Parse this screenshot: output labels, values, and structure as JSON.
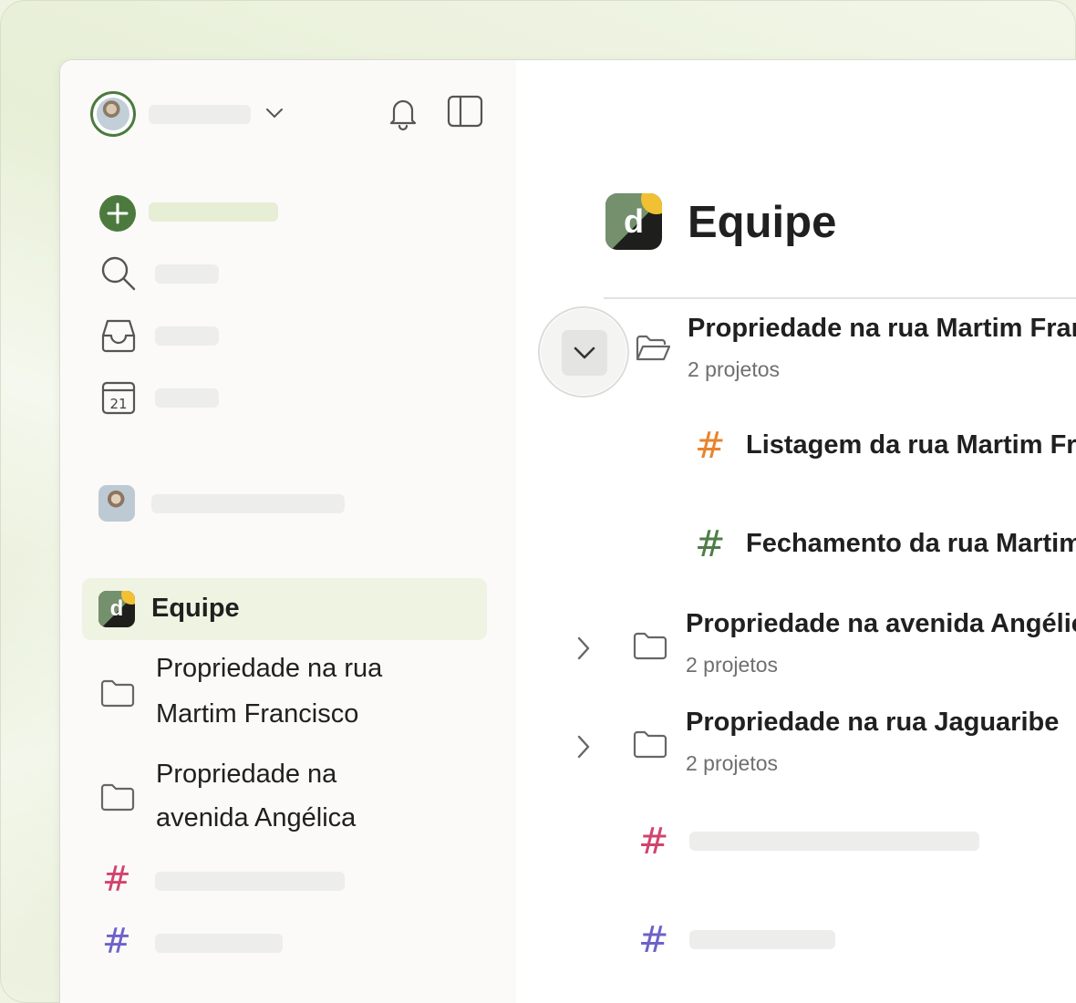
{
  "sidebar": {
    "icons": {
      "add": "plus-circle-icon",
      "search": "search-icon",
      "inbox": "inbox-icon",
      "calendar": "calendar-icon",
      "notifications": "bell-icon",
      "toggle_sidebar": "sidebar-toggle-icon"
    },
    "calendar_day": "21",
    "team": {
      "label": "Equipe",
      "logo_letter": "d"
    },
    "folders": [
      {
        "line1": "Propriedade na rua",
        "line2": "Martim Francisco"
      },
      {
        "line1": "Propriedade na",
        "line2": "avenida Angélica"
      }
    ]
  },
  "main": {
    "title": "Equipe",
    "logo_letter": "d",
    "folders": [
      {
        "title": "Propriedade na rua Martim Francisco",
        "subtitle": "2 projetos",
        "expanded": true,
        "projects": [
          {
            "title": "Listagem da rua Martim Francisco",
            "color": "#e8842d"
          },
          {
            "title": "Fechamento da rua Martim Francisco",
            "color": "#4f7d46"
          }
        ]
      },
      {
        "title": "Propriedade na avenida Angélica",
        "subtitle": "2 projetos",
        "expanded": false
      },
      {
        "title": "Propriedade na rua Jaguaribe",
        "subtitle": "2 projetos",
        "expanded": false
      }
    ]
  },
  "colors": {
    "accent_green": "#4c7a3e",
    "hash_orange": "#e8842d",
    "hash_green": "#4f7d46",
    "hash_pink": "#d1446d",
    "hash_purple": "#6d62c9"
  }
}
